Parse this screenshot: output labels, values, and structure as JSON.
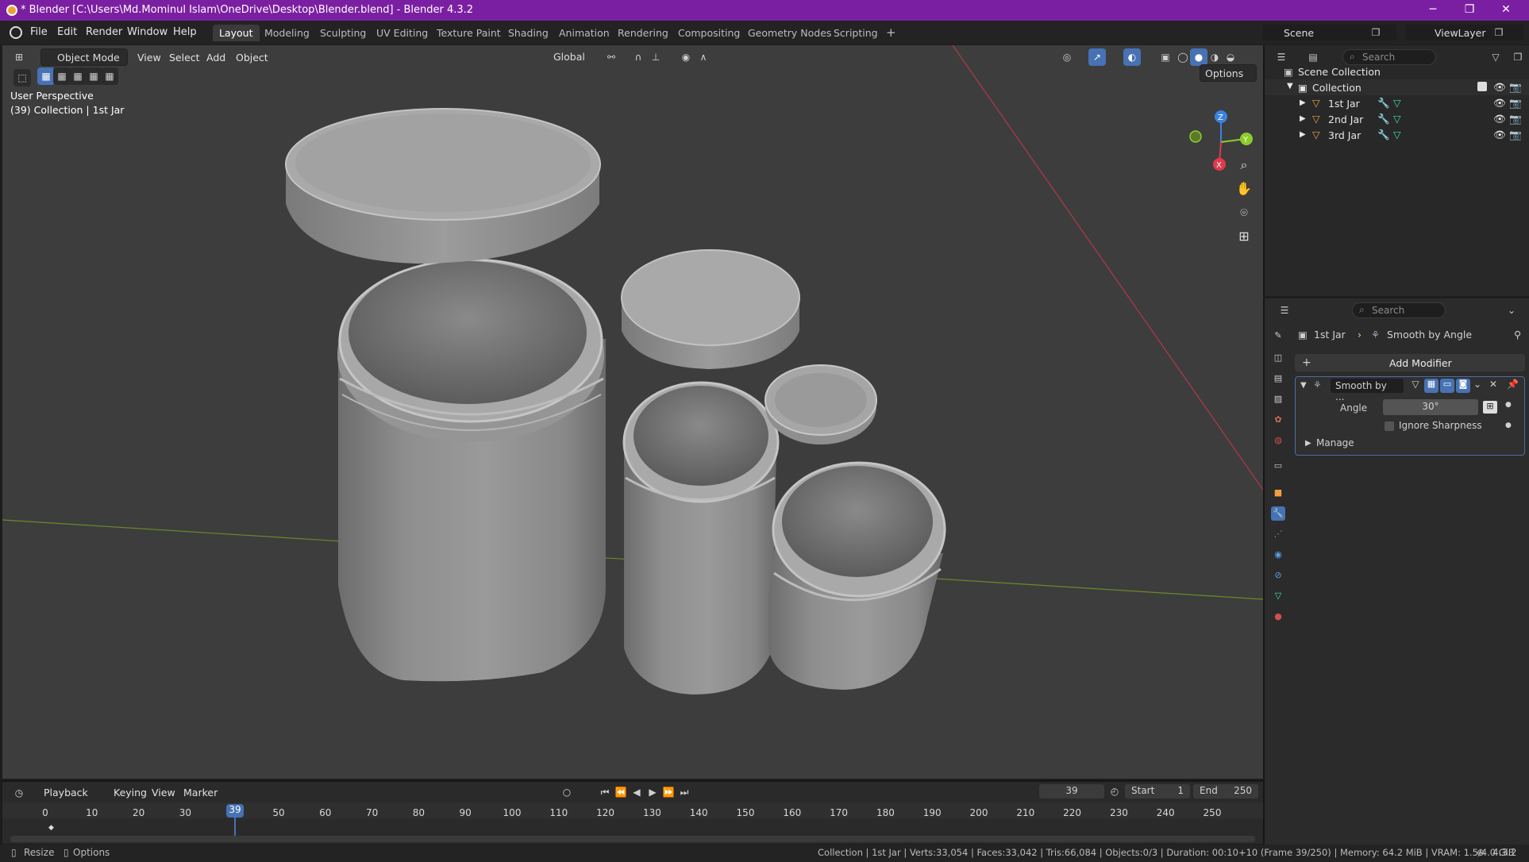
{
  "window": {
    "title": "* Blender [C:\\Users\\Md.Mominul Islam\\OneDrive\\Desktop\\Blender.blend] - Blender 4.3.2",
    "minimize": "─",
    "maximize": "❐",
    "close": "✕"
  },
  "menus": [
    "File",
    "Edit",
    "Render",
    "Window",
    "Help"
  ],
  "workspaces": [
    "Layout",
    "Modeling",
    "Sculpting",
    "UV Editing",
    "Texture Paint",
    "Shading",
    "Animation",
    "Rendering",
    "Compositing",
    "Geometry Nodes",
    "Scripting"
  ],
  "active_workspace": "Layout",
  "add_workspace": "+",
  "topright": {
    "scene": "Scene",
    "view_layer": "ViewLayer"
  },
  "viewport": {
    "mode": "Object Mode",
    "menus": [
      "View",
      "Select",
      "Add",
      "Object"
    ],
    "transform_orientation": "Global",
    "options": "Options",
    "overlay_line1": "User Perspective",
    "overlay_line2": "(39) Collection | 1st Jar",
    "gizmo": {
      "x": "X",
      "y": "Y",
      "z": "Z"
    }
  },
  "outliner": {
    "search_placeholder": "Search",
    "scene_collection": "Scene Collection",
    "collection": "Collection",
    "objects": [
      "1st Jar",
      "2nd Jar",
      "3rd Jar"
    ]
  },
  "properties": {
    "search_placeholder": "Search",
    "breadcrumb_object": "1st Jar",
    "breadcrumb_modifier": "Smooth by Angle",
    "add_modifier": "Add Modifier",
    "modifier_name": "Smooth by ...",
    "angle_label": "Angle",
    "angle_value": "30°",
    "ignore_sharpness": "Ignore Sharpness",
    "manage": "Manage"
  },
  "timeline": {
    "menus": [
      "Playback",
      "Keying",
      "View",
      "Marker"
    ],
    "current_frame": "39",
    "start_label": "Start",
    "start_value": "1",
    "end_label": "End",
    "end_value": "250",
    "ticks": [
      "0",
      "10",
      "20",
      "30",
      "39",
      "50",
      "60",
      "70",
      "80",
      "90",
      "100",
      "110",
      "120",
      "130",
      "140",
      "150",
      "160",
      "170",
      "180",
      "190",
      "200",
      "210",
      "220",
      "230",
      "240",
      "250"
    ]
  },
  "statusbar": {
    "left1": "Resize",
    "left2": "Options",
    "info": "Collection | 1st Jar | Verts:33,054 | Faces:33,042 | Tris:66,084 | Objects:0/3 | Duration: 00:10+10 (Frame 39/250) | Memory: 64.2 MiB | VRAM: 1.5/4.0 GiB",
    "version": "4.3.2"
  },
  "colors": {
    "title_bar": "#7b1fa2",
    "viewport_bg": "#3d3d3d",
    "accent": "#4772b3",
    "axis_x": "#e0394e",
    "axis_y": "#8ccd2a",
    "axis_z": "#3b82e0"
  }
}
